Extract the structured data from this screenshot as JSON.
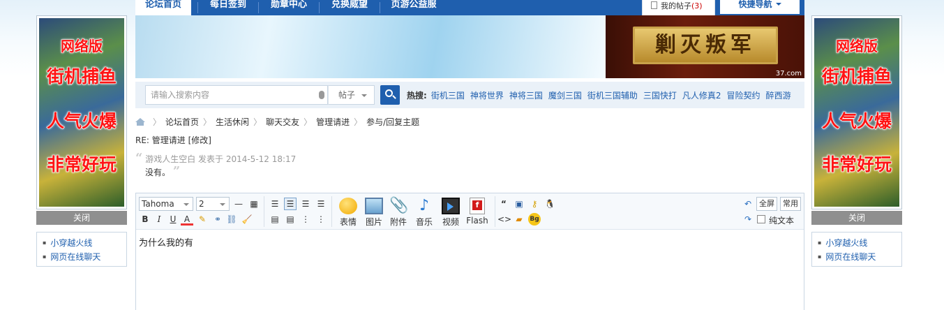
{
  "nav": {
    "tabs": [
      "论坛首页",
      "每日签到",
      "勋章中心",
      "兑换威望",
      "页游公益服"
    ],
    "my_posts_label": "我的帖子",
    "my_posts_count": "(3)",
    "quick_nav": "快捷导航"
  },
  "banner": {
    "plaque_text": "剿灭叛军",
    "watermark": "37.com"
  },
  "search": {
    "placeholder": "请输入搜索内容",
    "type": "帖子",
    "hot_label": "热搜:",
    "hot_items": [
      "街机三国",
      "神将世界",
      "神将三国",
      "魔剑三国",
      "街机三国辅助",
      "三国快打",
      "凡人修真2",
      "冒险契约",
      "醉西游"
    ]
  },
  "breadcrumb": [
    "论坛首页",
    "生活休闲",
    "聊天交友",
    "管理请进",
    "参与/回复主题"
  ],
  "post": {
    "title": "RE: 管理请进 [修改]",
    "quote_author_line": "游戏人生空白 发表于 2014-5-12 18:17",
    "quote_body": "没有。"
  },
  "editor": {
    "font": "Tahoma",
    "size": "2",
    "big_buttons": [
      "表情",
      "图片",
      "附件",
      "音乐",
      "视频",
      "Flash"
    ],
    "fullscreen": "全屏",
    "common": "常用",
    "plain_text": "纯文本",
    "content": "为什么我的有"
  },
  "side_ad": {
    "lines": [
      "网络版",
      "街机捕鱼",
      "人气火爆",
      "非常好玩"
    ],
    "close": "关闭",
    "links": [
      "小穿越火线",
      "网页在线聊天"
    ]
  },
  "colors": {
    "nav_blue": "#1f5fae",
    "ad_red": "#ff1414",
    "count_red": "#cc0000"
  }
}
